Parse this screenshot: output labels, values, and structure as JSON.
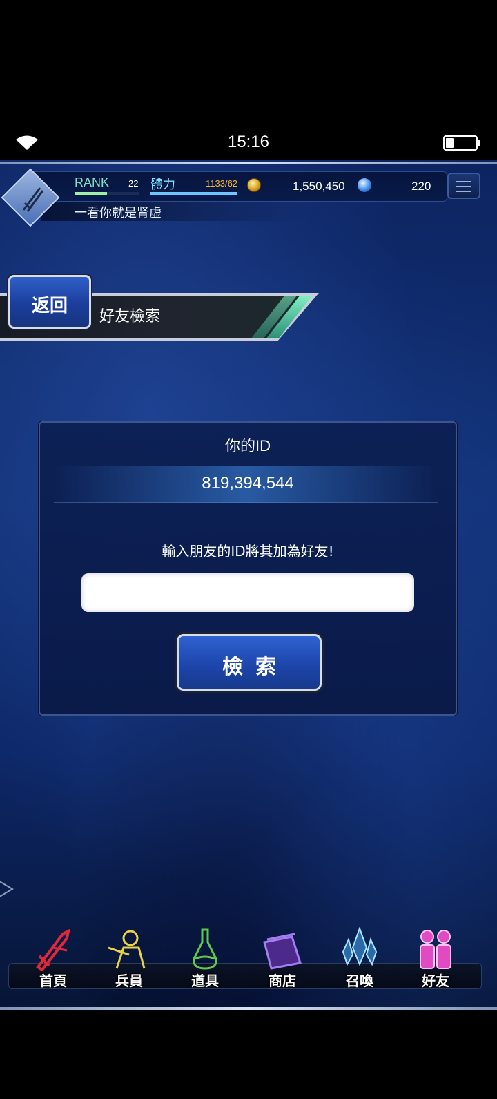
{
  "status_bar": {
    "time": "15:16",
    "wifi_icon": "wifi-icon",
    "battery_icon": "battery-icon",
    "battery_level": 0.25
  },
  "header": {
    "rank_label": "RANK",
    "rank_value": "22",
    "stamina_label": "體力",
    "stamina_value": "1133/62",
    "gil_value": "1,550,450",
    "lapis_value": "220",
    "player_name": "一看你就是肾虚",
    "rank_gauge_fraction": 0.5,
    "stamina_gauge_fraction": 1.0
  },
  "title_bar": {
    "back_label": "返回",
    "page_title": "好友檢索"
  },
  "panel": {
    "id_title": "你的ID",
    "id_value": "819,394,544",
    "instruction": "輸入朋友的ID將其加為好友!",
    "input_value": "",
    "input_placeholder": "",
    "search_label": "檢索"
  },
  "nav": {
    "items": [
      {
        "label": "首頁",
        "icon": "sword-icon",
        "color": "#e0283a"
      },
      {
        "label": "兵員",
        "icon": "hero-icon",
        "color": "#e8d24a"
      },
      {
        "label": "道具",
        "icon": "potion-icon",
        "color": "#5fc84e"
      },
      {
        "label": "商店",
        "icon": "shop-icon",
        "color": "#8a4ee0"
      },
      {
        "label": "召喚",
        "icon": "crystal-icon",
        "color": "#6fd0f2"
      },
      {
        "label": "好友",
        "icon": "friends-icon",
        "color": "#e04bc4"
      }
    ]
  }
}
